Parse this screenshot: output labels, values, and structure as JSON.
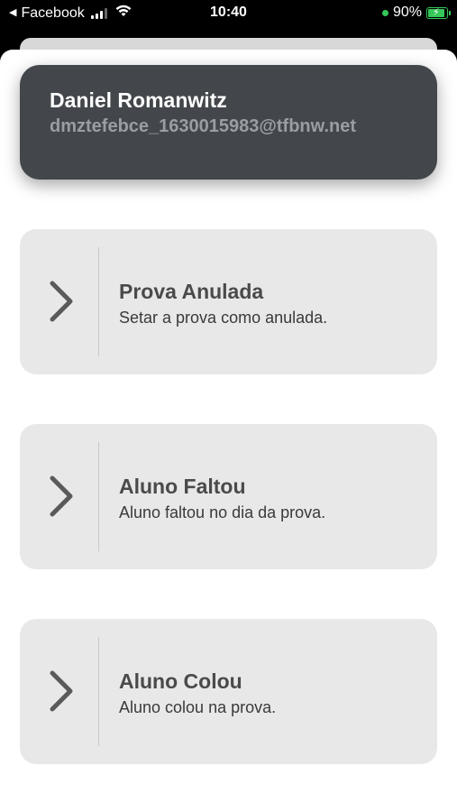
{
  "status_bar": {
    "back_app": "Facebook",
    "time": "10:40",
    "battery_percent": "90%",
    "battery_level": 0.9,
    "back_arrow_icon": "back-triangle-icon",
    "wifi_icon": "wifi-icon",
    "signal_icon": "signal-bars-icon",
    "battery_icon": "battery-charging-icon",
    "green_indicator_color": "#35c759"
  },
  "user": {
    "name": "Daniel Romanwitz",
    "email": "dmztefebce_1630015983@tfbnw.net"
  },
  "options": [
    {
      "title": "Prova Anulada",
      "description": "Setar a prova como anulada.",
      "icon": "chevron-right-icon"
    },
    {
      "title": "Aluno Faltou",
      "description": "Aluno faltou no dia da prova.",
      "icon": "chevron-right-icon"
    },
    {
      "title": "Aluno Colou",
      "description": "Aluno colou na prova.",
      "icon": "chevron-right-icon"
    }
  ],
  "colors": {
    "user_card_bg": "#43474b",
    "option_card_bg": "#e8e8e8",
    "email_text": "#9a9ea2"
  }
}
